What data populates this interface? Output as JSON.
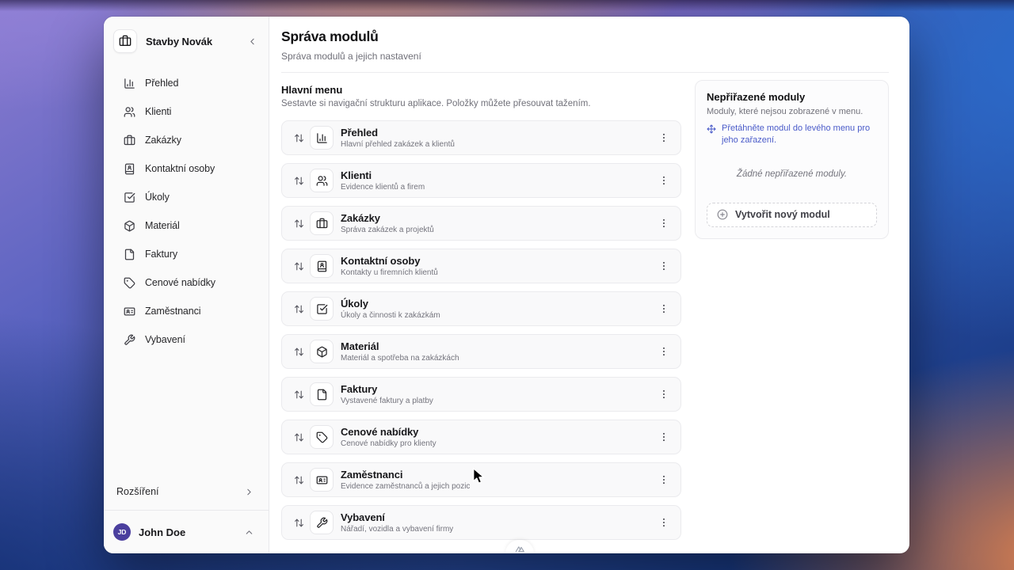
{
  "colors": {
    "accent_blue": "#4a5bc9",
    "avatar_purple": "#4b3f9e",
    "sidebar_bg": "#fafafa",
    "row_bg": "#f9f9fa"
  },
  "sidebar": {
    "brand": {
      "name": "Stavby Novák",
      "icon": "briefcase-icon"
    },
    "collapse_icon": "chevron-left-icon",
    "items": [
      {
        "label": "Přehled",
        "icon": "bar-chart-icon"
      },
      {
        "label": "Klienti",
        "icon": "users-icon"
      },
      {
        "label": "Zakázky",
        "icon": "briefcase-icon"
      },
      {
        "label": "Kontaktní osoby",
        "icon": "contact-book-icon"
      },
      {
        "label": "Úkoly",
        "icon": "square-check-icon"
      },
      {
        "label": "Materiál",
        "icon": "box-icon"
      },
      {
        "label": "Faktury",
        "icon": "file-icon"
      },
      {
        "label": "Cenové nabídky",
        "icon": "tag-icon"
      },
      {
        "label": "Zaměstnanci",
        "icon": "id-card-icon"
      },
      {
        "label": "Vybavení",
        "icon": "wrench-icon"
      }
    ],
    "extensions_label": "Rozšíření",
    "user": {
      "initials": "JD",
      "name": "John Doe"
    }
  },
  "page": {
    "title": "Správa modulů",
    "subtitle": "Správa modulů a jejich nastavení"
  },
  "main_menu": {
    "title": "Hlavní menu",
    "description": "Sestavte si navigační strukturu aplikace. Položky můžete přesouvat tažením.",
    "modules": [
      {
        "title": "Přehled",
        "description": "Hlavní přehled zakázek a klientů",
        "icon": "bar-chart-icon"
      },
      {
        "title": "Klienti",
        "description": "Evidence klientů a firem",
        "icon": "users-icon"
      },
      {
        "title": "Zakázky",
        "description": "Správa zakázek a projektů",
        "icon": "briefcase-icon"
      },
      {
        "title": "Kontaktní osoby",
        "description": "Kontakty u firemních klientů",
        "icon": "contact-book-icon"
      },
      {
        "title": "Úkoly",
        "description": "Úkoly a činnosti k zakázkám",
        "icon": "square-check-icon"
      },
      {
        "title": "Materiál",
        "description": "Materiál a spotřeba na zakázkách",
        "icon": "box-icon"
      },
      {
        "title": "Faktury",
        "description": "Vystavené faktury a platby",
        "icon": "file-icon"
      },
      {
        "title": "Cenové nabídky",
        "description": "Cenové nabídky pro klienty",
        "icon": "tag-icon"
      },
      {
        "title": "Zaměstnanci",
        "description": "Evidence zaměstnanců a jejich pozic",
        "icon": "id-card-icon"
      },
      {
        "title": "Vybavení",
        "description": "Nářadí, vozidla a vybavení firmy",
        "icon": "wrench-icon"
      }
    ]
  },
  "unassigned_panel": {
    "title": "Nepřiřazené moduly",
    "description": "Moduly, které nejsou zobrazené v menu.",
    "drag_hint": "Přetáhněte modul do levého menu pro jeho zařazení.",
    "empty_state": "Žádné nepřiřazené moduly.",
    "create_button_label": "Vytvořit nový modul"
  }
}
